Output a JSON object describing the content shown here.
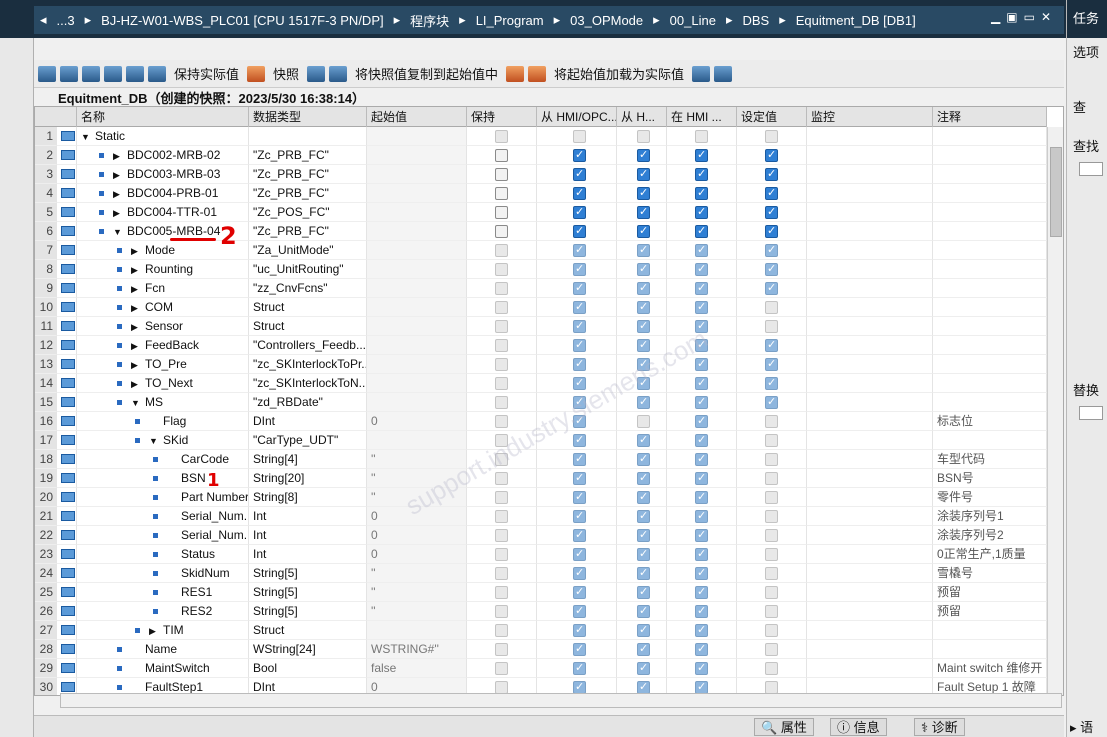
{
  "breadcrumb": [
    "...3",
    "BJ-HZ-W01-WBS_PLC01 [CPU 1517F-3 PN/DP]",
    "程序块",
    "LI_Program",
    "03_OPMode",
    "00_Line",
    "DBS",
    "Equitment_DB [DB1]"
  ],
  "right_panel": {
    "title": "任务",
    "options": "选项",
    "search": "查",
    "find": "查找",
    "replace": "替换"
  },
  "toolbar": {
    "keep_actual": "保持实际值",
    "snapshot": "快照",
    "copy_snapshot": "将快照值复制到起始值中",
    "load_start": "将起始值加载为实际值"
  },
  "db_title": "Equitment_DB（创建的快照：2023/5/30 16:38:14）",
  "columns": {
    "name": "名称",
    "type": "数据类型",
    "start": "起始值",
    "retain": "保持",
    "hmi1": "从 HMI/OPC...",
    "hmi2": "从 H...",
    "hmi3": "在 HMI ...",
    "setpoint": "设定值",
    "monitor": "监控",
    "comment": "注释"
  },
  "rows": [
    {
      "n": "1",
      "indent": 0,
      "arrow": "down",
      "bullet": false,
      "name": "Static",
      "type": "",
      "start": "",
      "c": [
        "d0",
        "d0",
        "d0",
        "d0",
        "d0"
      ],
      "cmt": ""
    },
    {
      "n": "2",
      "indent": 1,
      "arrow": "right",
      "bullet": true,
      "name": "BDC002-MRB-02",
      "type": "\"Zc_PRB_FC\"",
      "start": "",
      "c": [
        "0",
        "1",
        "1",
        "1",
        "1"
      ],
      "cmt": ""
    },
    {
      "n": "3",
      "indent": 1,
      "arrow": "right",
      "bullet": true,
      "name": "BDC003-MRB-03",
      "type": "\"Zc_PRB_FC\"",
      "start": "",
      "c": [
        "0",
        "1",
        "1",
        "1",
        "1"
      ],
      "cmt": ""
    },
    {
      "n": "4",
      "indent": 1,
      "arrow": "right",
      "bullet": true,
      "name": "BDC004-PRB-01",
      "type": "\"Zc_PRB_FC\"",
      "start": "",
      "c": [
        "0",
        "1",
        "1",
        "1",
        "1"
      ],
      "cmt": ""
    },
    {
      "n": "5",
      "indent": 1,
      "arrow": "right",
      "bullet": true,
      "name": "BDC004-TTR-01",
      "type": "\"Zc_POS_FC\"",
      "start": "",
      "c": [
        "0",
        "1",
        "1",
        "1",
        "1"
      ],
      "cmt": ""
    },
    {
      "n": "6",
      "indent": 1,
      "arrow": "down",
      "bullet": true,
      "name": "BDC005-MRB-04",
      "type": "\"Zc_PRB_FC\"",
      "start": "",
      "c": [
        "0",
        "1",
        "1",
        "1",
        "1"
      ],
      "cmt": ""
    },
    {
      "n": "7",
      "indent": 2,
      "arrow": "right",
      "bullet": true,
      "name": "Mode",
      "type": "\"Za_UnitMode\"",
      "start": "",
      "c": [
        "d0",
        "d1",
        "d1",
        "d1",
        "d1"
      ],
      "cmt": ""
    },
    {
      "n": "8",
      "indent": 2,
      "arrow": "right",
      "bullet": true,
      "name": "Rounting",
      "type": "\"uc_UnitRouting\"",
      "start": "",
      "c": [
        "d0",
        "d1",
        "d1",
        "d1",
        "d1"
      ],
      "cmt": ""
    },
    {
      "n": "9",
      "indent": 2,
      "arrow": "right",
      "bullet": true,
      "name": "Fcn",
      "type": "\"zz_CnvFcns\"",
      "start": "",
      "c": [
        "d0",
        "d1",
        "d1",
        "d1",
        "d1"
      ],
      "cmt": ""
    },
    {
      "n": "10",
      "indent": 2,
      "arrow": "right",
      "bullet": true,
      "name": "COM",
      "type": "Struct",
      "start": "",
      "c": [
        "d0",
        "d1",
        "d1",
        "d1",
        "d0"
      ],
      "cmt": ""
    },
    {
      "n": "11",
      "indent": 2,
      "arrow": "right",
      "bullet": true,
      "name": "Sensor",
      "type": "Struct",
      "start": "",
      "c": [
        "d0",
        "d1",
        "d1",
        "d1",
        "d0"
      ],
      "cmt": ""
    },
    {
      "n": "12",
      "indent": 2,
      "arrow": "right",
      "bullet": true,
      "name": "FeedBack",
      "type": "\"Controllers_Feedb...",
      "start": "",
      "c": [
        "d0",
        "d1",
        "d1",
        "d1",
        "d1"
      ],
      "cmt": ""
    },
    {
      "n": "13",
      "indent": 2,
      "arrow": "right",
      "bullet": true,
      "name": "TO_Pre",
      "type": "\"zc_SKInterlockToPr...",
      "start": "",
      "c": [
        "d0",
        "d1",
        "d1",
        "d1",
        "d1"
      ],
      "cmt": ""
    },
    {
      "n": "14",
      "indent": 2,
      "arrow": "right",
      "bullet": true,
      "name": "TO_Next",
      "type": "\"zc_SKInterlockToN...",
      "start": "",
      "c": [
        "d0",
        "d1",
        "d1",
        "d1",
        "d1"
      ],
      "cmt": ""
    },
    {
      "n": "15",
      "indent": 2,
      "arrow": "down",
      "bullet": true,
      "name": "MS",
      "type": "\"zd_RBDate\"",
      "start": "",
      "c": [
        "d0",
        "d1",
        "d1",
        "d1",
        "d1"
      ],
      "cmt": ""
    },
    {
      "n": "16",
      "indent": 3,
      "arrow": "",
      "bullet": true,
      "name": "Flag",
      "type": "DInt",
      "start": "0",
      "c": [
        "d0",
        "d1",
        "d0",
        "d1",
        "d0"
      ],
      "cmt": "标志位"
    },
    {
      "n": "17",
      "indent": 3,
      "arrow": "down",
      "bullet": true,
      "name": "SKid",
      "type": "\"CarType_UDT\"",
      "start": "",
      "c": [
        "d0",
        "d1",
        "d1",
        "d1",
        "d0"
      ],
      "cmt": ""
    },
    {
      "n": "18",
      "indent": 4,
      "arrow": "",
      "bullet": true,
      "name": "CarCode",
      "type": "String[4]",
      "start": "''",
      "c": [
        "d0",
        "d1",
        "d1",
        "d1",
        "d0"
      ],
      "cmt": "车型代码"
    },
    {
      "n": "19",
      "indent": 4,
      "arrow": "",
      "bullet": true,
      "name": "BSN",
      "type": "String[20]",
      "start": "''",
      "c": [
        "d0",
        "d1",
        "d1",
        "d1",
        "d0"
      ],
      "cmt": "BSN号"
    },
    {
      "n": "20",
      "indent": 4,
      "arrow": "",
      "bullet": true,
      "name": "Part Number",
      "type": "String[8]",
      "start": "''",
      "c": [
        "d0",
        "d1",
        "d1",
        "d1",
        "d0"
      ],
      "cmt": "零件号"
    },
    {
      "n": "21",
      "indent": 4,
      "arrow": "",
      "bullet": true,
      "name": "Serial_Num...",
      "type": "Int",
      "start": "0",
      "c": [
        "d0",
        "d1",
        "d1",
        "d1",
        "d0"
      ],
      "cmt": "涂装序列号1"
    },
    {
      "n": "22",
      "indent": 4,
      "arrow": "",
      "bullet": true,
      "name": "Serial_Num...",
      "type": "Int",
      "start": "0",
      "c": [
        "d0",
        "d1",
        "d1",
        "d1",
        "d0"
      ],
      "cmt": "涂装序列号2"
    },
    {
      "n": "23",
      "indent": 4,
      "arrow": "",
      "bullet": true,
      "name": "Status",
      "type": "Int",
      "start": "0",
      "c": [
        "d0",
        "d1",
        "d1",
        "d1",
        "d0"
      ],
      "cmt": "0正常生产,1质量"
    },
    {
      "n": "24",
      "indent": 4,
      "arrow": "",
      "bullet": true,
      "name": "SkidNum",
      "type": "String[5]",
      "start": "''",
      "c": [
        "d0",
        "d1",
        "d1",
        "d1",
        "d0"
      ],
      "cmt": "雪橇号"
    },
    {
      "n": "25",
      "indent": 4,
      "arrow": "",
      "bullet": true,
      "name": "RES1",
      "type": "String[5]",
      "start": "''",
      "c": [
        "d0",
        "d1",
        "d1",
        "d1",
        "d0"
      ],
      "cmt": "预留"
    },
    {
      "n": "26",
      "indent": 4,
      "arrow": "",
      "bullet": true,
      "name": "RES2",
      "type": "String[5]",
      "start": "''",
      "c": [
        "d0",
        "d1",
        "d1",
        "d1",
        "d0"
      ],
      "cmt": "预留"
    },
    {
      "n": "27",
      "indent": 3,
      "arrow": "right",
      "bullet": true,
      "name": "TIM",
      "type": "Struct",
      "start": "",
      "c": [
        "d0",
        "d1",
        "d1",
        "d1",
        "d0"
      ],
      "cmt": ""
    },
    {
      "n": "28",
      "indent": 2,
      "arrow": "",
      "bullet": true,
      "name": "Name",
      "type": "WString[24]",
      "start": "WSTRING#''",
      "c": [
        "d0",
        "d1",
        "d1",
        "d1",
        "d0"
      ],
      "cmt": ""
    },
    {
      "n": "29",
      "indent": 2,
      "arrow": "",
      "bullet": true,
      "name": "MaintSwitch",
      "type": "Bool",
      "start": "false",
      "c": [
        "d0",
        "d1",
        "d1",
        "d1",
        "d0"
      ],
      "cmt": "Maint switch 维修开"
    },
    {
      "n": "30",
      "indent": 2,
      "arrow": "",
      "bullet": true,
      "name": "FaultStep1",
      "type": "DInt",
      "start": "0",
      "c": [
        "d0",
        "d1",
        "d1",
        "d1",
        "d0"
      ],
      "cmt": "Fault Setup 1 故障"
    }
  ],
  "statusbar": {
    "properties": "属性",
    "info": "信息",
    "diagnostics": "诊断",
    "language": "语"
  },
  "annotations": [
    "2",
    "1"
  ]
}
